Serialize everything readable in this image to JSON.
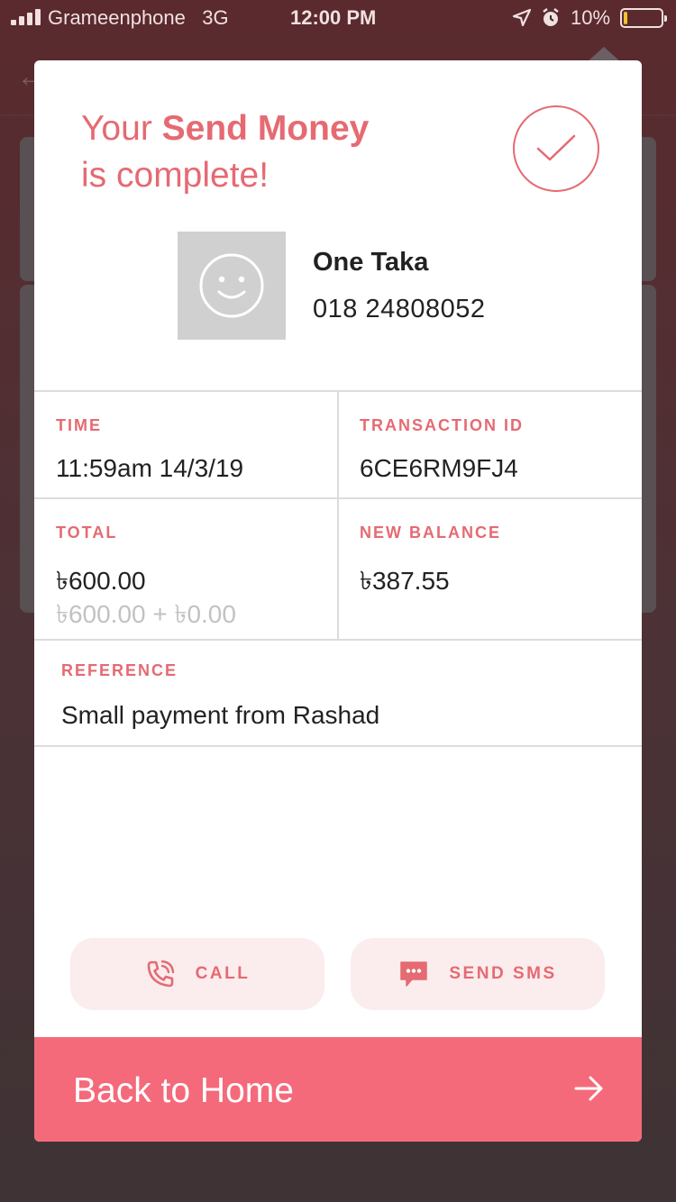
{
  "status_bar": {
    "carrier": "Grameenphone",
    "network": "3G",
    "time": "12:00 PM",
    "battery_percent": "10%",
    "battery_level": 0.1,
    "battery_color": "#f2c230"
  },
  "modal": {
    "title_prefix": "Your ",
    "title_bold": "Send Money",
    "title_suffix": "is complete!",
    "status_icon": "checkmark-icon",
    "accent_color": "#e56a72",
    "contact": {
      "avatar_icon": "smiley-face-icon",
      "name": "One Taka",
      "phone": "018 24808052"
    },
    "details": {
      "time_label": "TIME",
      "time_value": "11:59am 14/3/19",
      "transaction_label": "TRANSACTION ID",
      "transaction_value": "6CE6RM9FJ4",
      "total_label": "TOTAL",
      "total_value": "৳600.00",
      "total_breakdown": "৳600.00 + ৳0.00",
      "balance_label": "NEW BALANCE",
      "balance_value": "৳387.55",
      "reference_label": "REFERENCE",
      "reference_value": "Small payment from Rashad"
    },
    "actions": {
      "call_label": "CALL",
      "call_icon": "phone-call-icon",
      "sms_label": "SEND SMS",
      "sms_icon": "chat-bubble-icon"
    },
    "home_button": {
      "label": "Back to Home",
      "icon": "arrow-right-icon",
      "color": "#f46a7b"
    }
  }
}
